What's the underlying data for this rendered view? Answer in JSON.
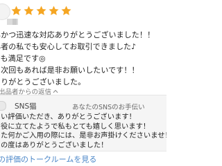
{
  "review": {
    "rating": 5,
    "star_color": "#f5a623",
    "lines": [
      "早かつ迅速な対応ありがとうございました！！",
      "心者の私でも安心してお取引できました♪",
      "ても満足です◎",
      "た次回もあれば是非お願いしたいです！！",
      "ありがとうございました。"
    ]
  },
  "seller_reply": {
    "label": "出品者からの返信",
    "shop_name": "SNS猫",
    "shop_subtitle": "あなたのSNSのお手伝い",
    "lines": [
      "い評価いただき、ありがとうございます！",
      "役に立てたようで私もとても嬉しく思います！",
      "た何かご入用の際には、是非お声掛けくださいませ！",
      "の度はありがとうございました！"
    ]
  },
  "footer": {
    "link_label": "の評価のトークルームを見る"
  },
  "colors": {
    "link": "#4a86c8",
    "reply_background": "#f5f5f5"
  },
  "icons": {
    "star": "star-icon",
    "reply_chevron": "chevron-up-icon"
  }
}
